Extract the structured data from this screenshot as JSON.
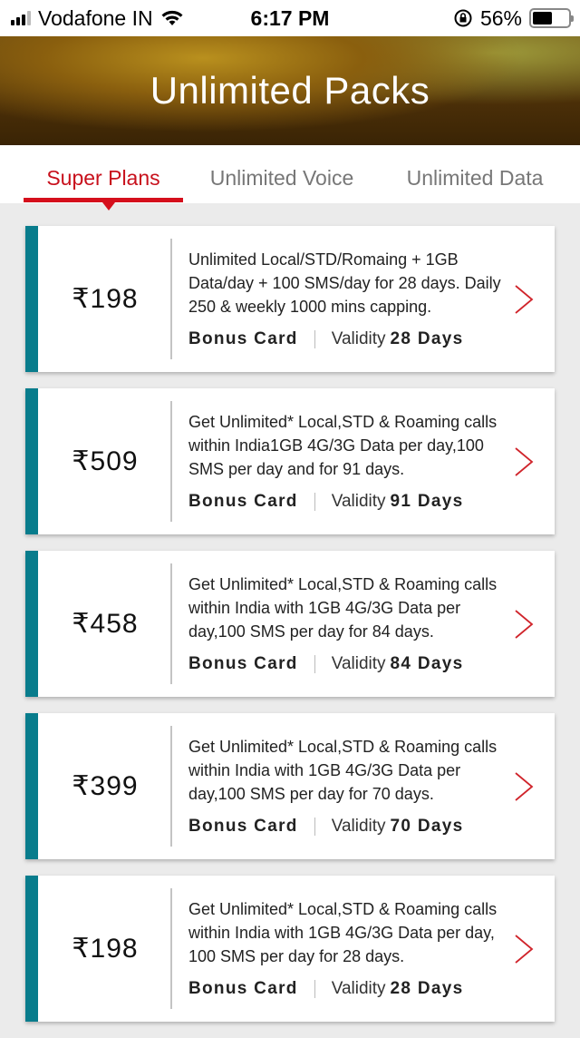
{
  "status_bar": {
    "carrier": "Vodafone IN",
    "time": "6:17 PM",
    "battery_percent": "56%",
    "battery_level": 0.56
  },
  "header": {
    "title": "Unlimited Packs"
  },
  "tabs": [
    {
      "label": "Super Plans",
      "active": true
    },
    {
      "label": "Unlimited Voice",
      "active": false
    },
    {
      "label": "Unlimited Data",
      "active": false
    }
  ],
  "colors": {
    "accent_red": "#d50f1c",
    "card_accent_teal": "#087c8c"
  },
  "plans": [
    {
      "price": "₹198",
      "description": "Unlimited Local/STD/Romaing + 1GB Data/day + 100 SMS/day for 28 days. Daily 250 & weekly 1000 mins capping.",
      "bonus": "Bonus Card",
      "validity_label": "Validity",
      "validity_value": "28 Days"
    },
    {
      "price": "₹509",
      "description": "Get Unlimited* Local,STD & Roaming calls within India1GB 4G/3G Data per day,100 SMS per day and for 91 days.",
      "bonus": "Bonus Card",
      "validity_label": "Validity",
      "validity_value": "91 Days"
    },
    {
      "price": "₹458",
      "description": "Get Unlimited* Local,STD & Roaming calls within India with 1GB 4G/3G Data per day,100 SMS per day for 84 days.",
      "bonus": "Bonus Card",
      "validity_label": "Validity",
      "validity_value": "84 Days"
    },
    {
      "price": "₹399",
      "description": "Get Unlimited* Local,STD & Roaming calls within India with 1GB 4G/3G Data per day,100 SMS per day for 70 days.",
      "bonus": "Bonus Card",
      "validity_label": "Validity",
      "validity_value": "70 Days"
    },
    {
      "price": "₹198",
      "description": "Get Unlimited* Local,STD & Roaming calls within India with 1GB 4G/3G Data per day, 100 SMS per day for 28 days.",
      "bonus": "Bonus Card",
      "validity_label": "Validity",
      "validity_value": "28 Days"
    }
  ]
}
